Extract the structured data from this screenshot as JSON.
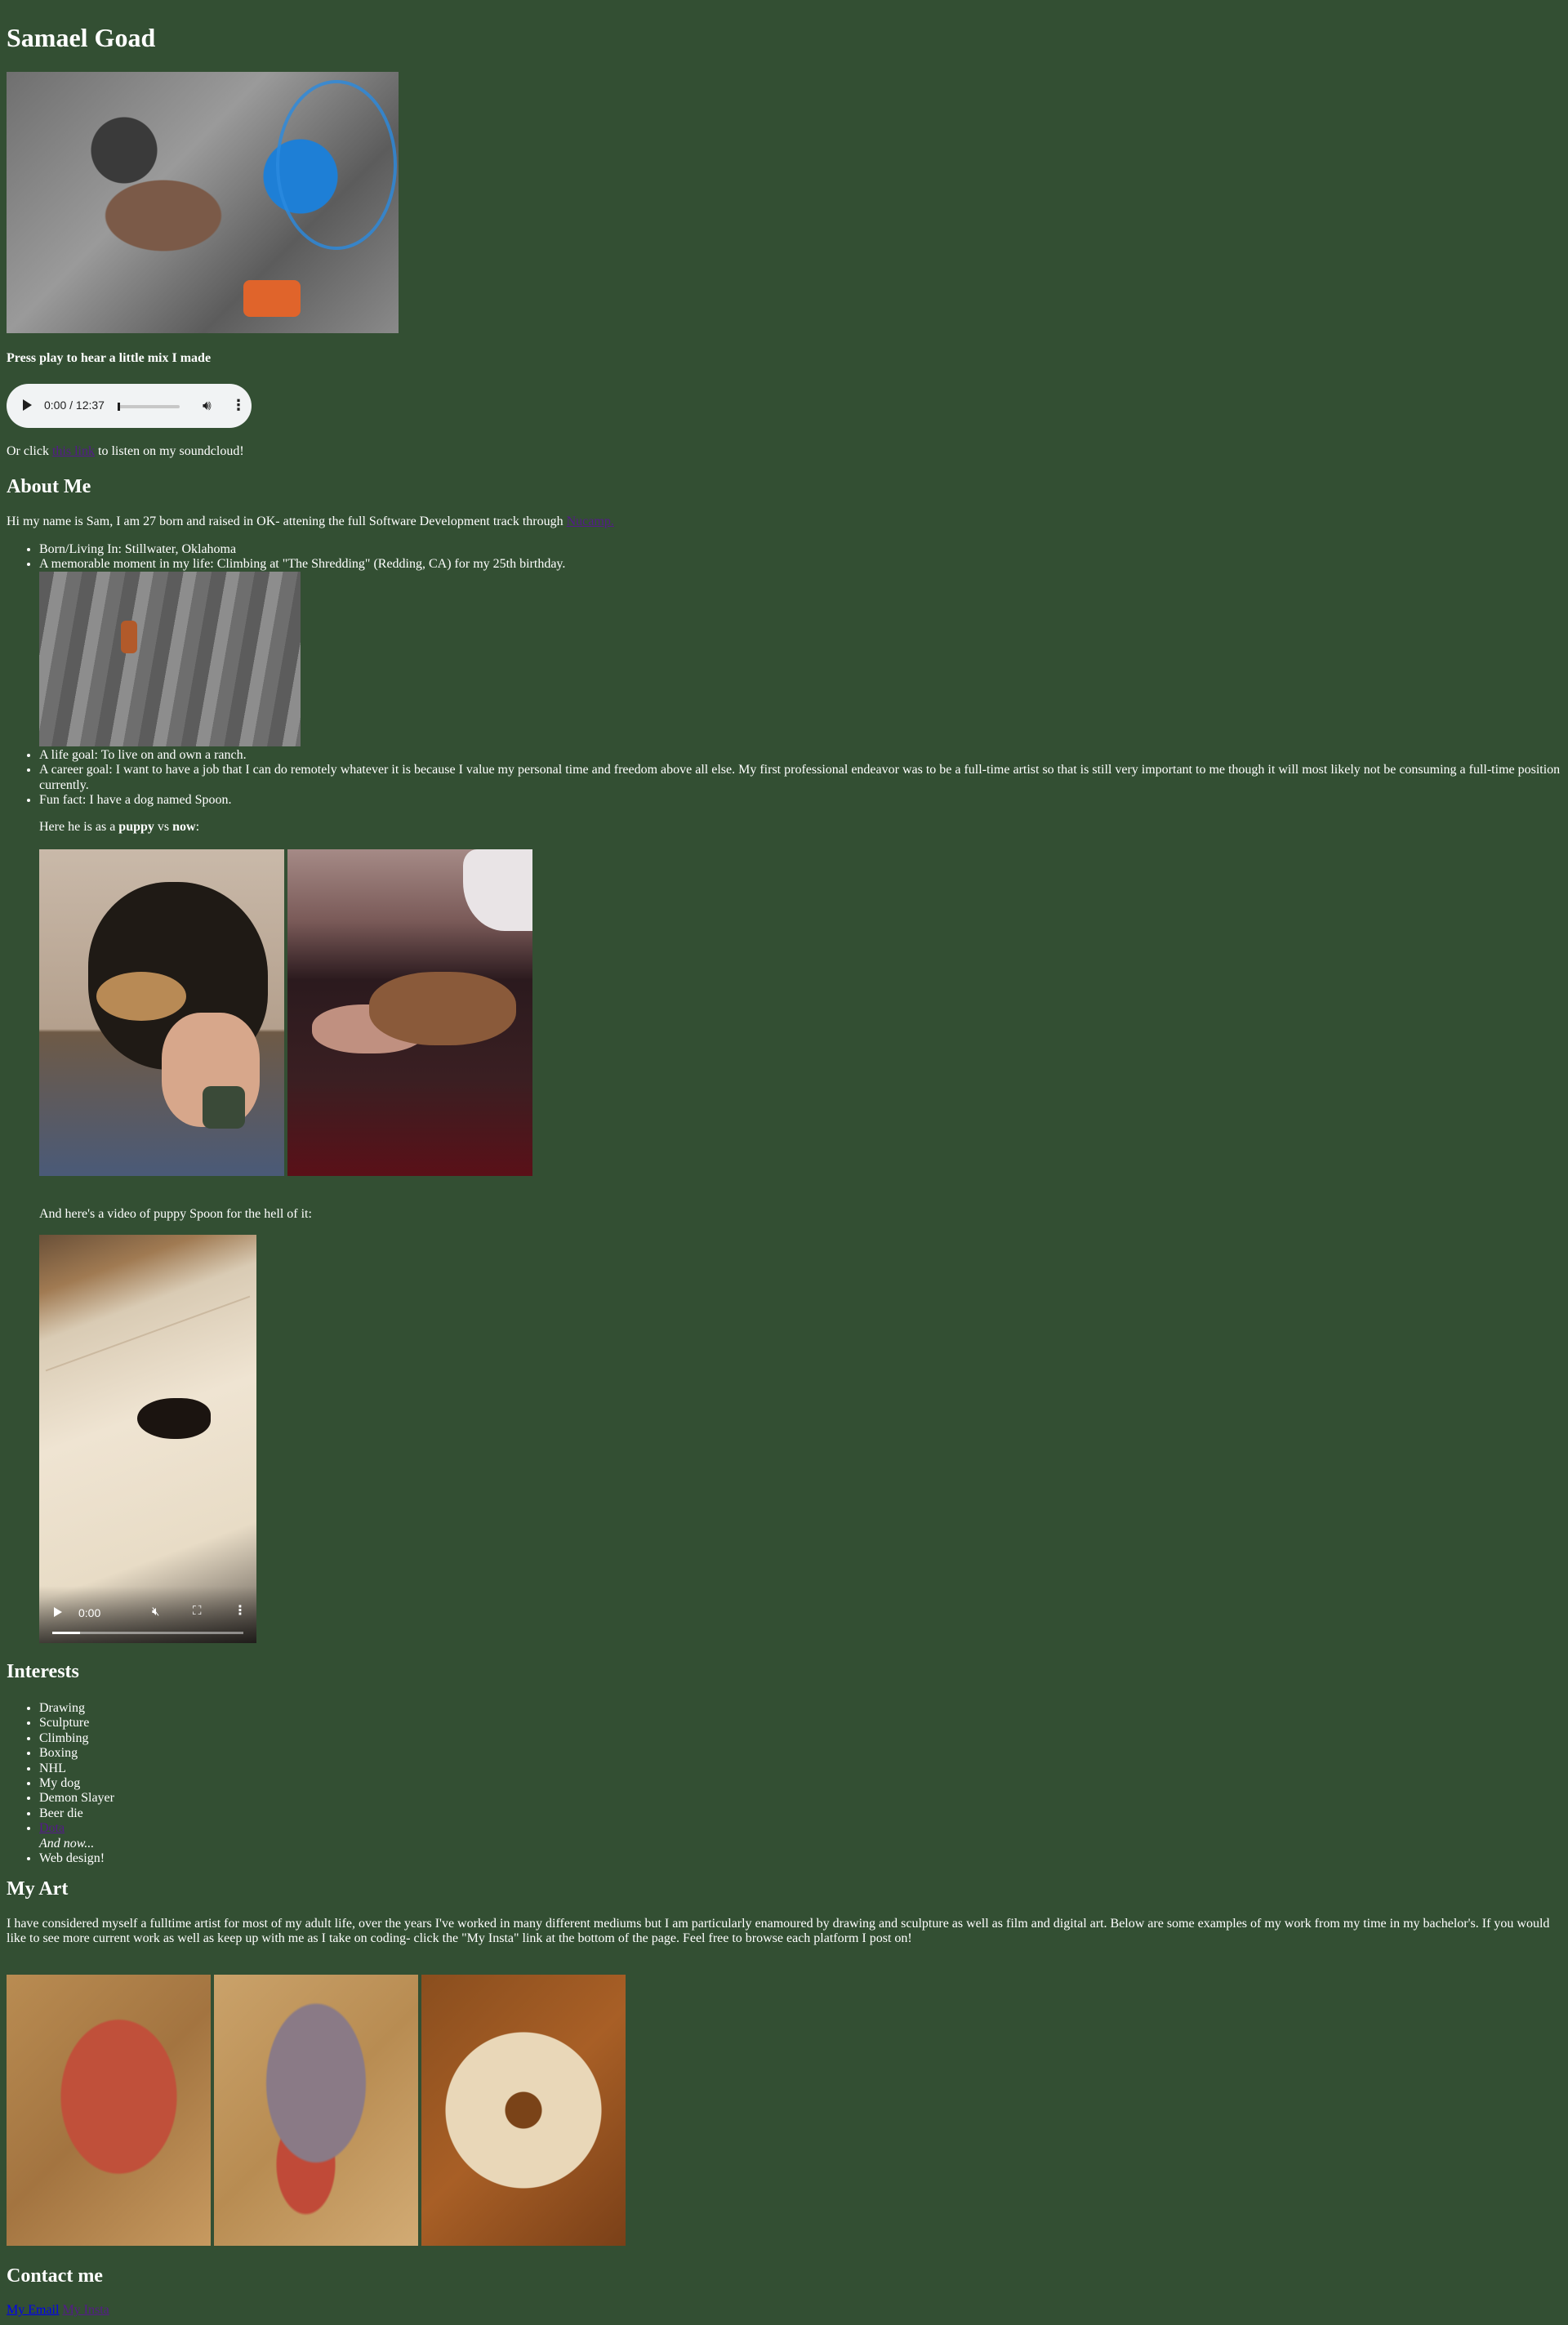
{
  "title": "Samael Goad",
  "audio_section": {
    "heading": "Press play to hear a little mix I made",
    "time": "0:00 / 12:37",
    "note_prefix": "Or click",
    "note_link": "this link",
    "note_suffix": "to listen on my soundcloud!"
  },
  "about": {
    "heading": "About Me",
    "intro_prefix": "Hi my name is Sam, I am 27 born and raised in OK- attening the full Software Development track through",
    "intro_link": "Nucamp.",
    "items": [
      "Born/Living In: Stillwater, Oklahoma",
      "A memorable moment in my life: Climbing at \"The Shredding\" (Redding, CA) for my 25th birthday.",
      "A life goal: To live on and own a ranch.",
      "A career goal: I want to have a job that I can do remotely whatever it is because I value my personal time and freedom above all else. My first professional endeavor was to be a full-time artist so that is still very important to me though it will most likely not be consuming a full-time position currently.",
      "Fun fact: I have a dog named Spoon."
    ],
    "dog_caption_prefix": "Here he is as a",
    "dog_caption_puppy": "puppy",
    "dog_caption_vs": "vs",
    "dog_caption_now": "now",
    "dog_caption_suffix": ":",
    "video_caption": "And here's a video of puppy Spoon for the hell of it:",
    "video_time": "0:00"
  },
  "interests": {
    "heading": "Interests",
    "items": [
      "Drawing",
      "Sculpture",
      "Climbing",
      "Boxing",
      "NHL",
      "My dog",
      "Demon Slayer",
      "Beer die"
    ],
    "link_item": "Dota",
    "and_now": "And now...",
    "last_item": "Web design!"
  },
  "art": {
    "heading": "My Art",
    "text": "I have considered myself a fulltime artist for most of my adult life, over the years I've worked in many different mediums but I am particularly enamoured by drawing and sculpture as well as film and digital art. Below are some examples of my work from my time in my bachelor's. If you would like to see more current work as well as keep up with me as I take on coding- click the \"My Insta\" link at the bottom of the page. Feel free to browse each platform I post on!"
  },
  "contact": {
    "heading": "Contact me",
    "email_link": "My Email",
    "insta_link": "My Insta"
  },
  "colors": {
    "background": "#334f33",
    "text": "#ffffff",
    "visited_link": "#551a8b",
    "link": "#0000ee"
  }
}
